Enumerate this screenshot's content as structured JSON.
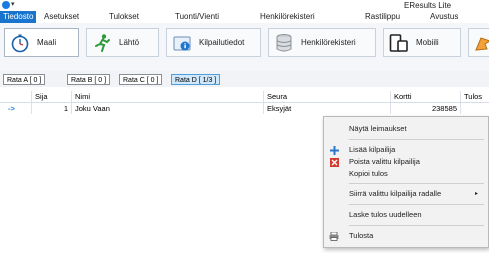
{
  "window": {
    "title": "EResults Lite"
  },
  "menu": {
    "items": [
      {
        "label": "Tiedosto",
        "active": true
      },
      {
        "label": "Asetukset"
      },
      {
        "label": "Tulokset"
      },
      {
        "label": "Tuonti/Vienti"
      },
      {
        "label": "Henkilörekisteri"
      },
      {
        "label": "Rastilippu"
      },
      {
        "label": "Avustus"
      }
    ]
  },
  "toolbar": {
    "tabs": [
      {
        "label": "Maali",
        "icon": "stopwatch-icon",
        "selected": true
      },
      {
        "label": "Lähtö",
        "icon": "runner-icon"
      },
      {
        "label": "Kilpailutiedot",
        "icon": "info-icon"
      },
      {
        "label": "Henkilörekisteri",
        "icon": "database-icon"
      },
      {
        "label": "Mobiili",
        "icon": "mobile-icon"
      },
      {
        "label": "R",
        "icon": "flag-icon"
      }
    ]
  },
  "races": [
    {
      "label": "Rata A [ 0 ]"
    },
    {
      "label": "Rata B [ 0 ]"
    },
    {
      "label": "Rata C [ 0 ]"
    },
    {
      "label": "Rata D [ 1/3 ]",
      "selected": true
    }
  ],
  "table": {
    "columns": [
      "Sija",
      "Nimi",
      "Seura",
      "Kortti",
      "Tulos"
    ],
    "rows": [
      {
        "indicator": "->",
        "sija": "1",
        "nimi": "Joku Vaan",
        "seura": "Eksyjät",
        "kortti": "238585",
        "tulos": ""
      }
    ]
  },
  "context_menu": {
    "items": [
      {
        "label": "Näytä leimaukset"
      },
      {
        "label": "Lisää kilpailija",
        "icon": "plus-icon"
      },
      {
        "label": "Poista valittu kilpailija",
        "icon": "delete-icon"
      },
      {
        "label": "Kopioi tulos"
      },
      {
        "label": "Siirrä valittu kilpailija radalle",
        "submenu": true
      },
      {
        "label": "Laske tulos uudelleen"
      },
      {
        "label": "Tulosta",
        "icon": "printer-icon"
      }
    ],
    "submenu_arrow": "▸"
  },
  "colors": {
    "accent": "#1874cd",
    "selected_race": "#cfe8fb",
    "menu_bg": "#f2f2f2"
  }
}
